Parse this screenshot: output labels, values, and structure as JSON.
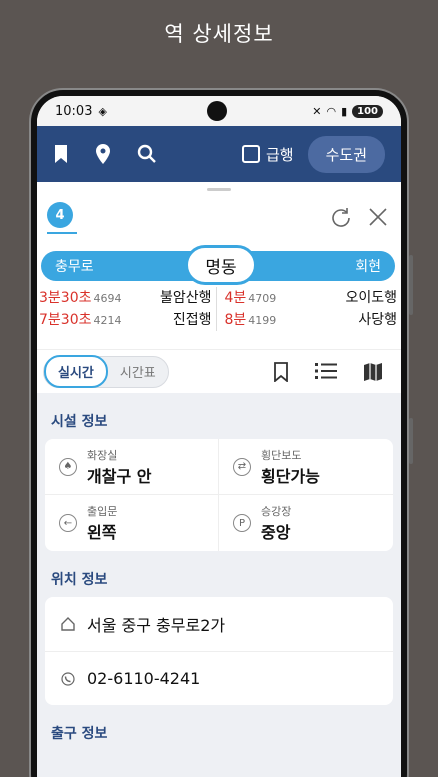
{
  "banner": {
    "title": "역 상세정보"
  },
  "statusbar": {
    "time": "10:03",
    "battery": "100"
  },
  "topbar": {
    "express_label": "급행",
    "region_label": "수도권"
  },
  "line": {
    "number": "4"
  },
  "stations": {
    "prev": "충무로",
    "current": "명동",
    "next": "회현"
  },
  "arrivals": {
    "left": [
      {
        "time": "3분30초",
        "train": "4694",
        "dest": "불암산행"
      },
      {
        "time": "7분30초",
        "train": "4214",
        "dest": "진접행"
      }
    ],
    "right": [
      {
        "time": "4분",
        "train": "4709",
        "dest": "오이도행"
      },
      {
        "time": "8분",
        "train": "4199",
        "dest": "사당행"
      }
    ]
  },
  "mode": {
    "realtime": "실시간",
    "timetable": "시간표"
  },
  "facility": {
    "title": "시설 정보",
    "items": [
      {
        "label": "화장실",
        "value": "개찰구 안"
      },
      {
        "label": "횡단보도",
        "value": "횡단가능"
      },
      {
        "label": "출입문",
        "value": "왼쪽"
      },
      {
        "label": "승강장",
        "value": "중앙"
      }
    ]
  },
  "location": {
    "title": "위치 정보",
    "address": "서울 중구 충무로2가",
    "phone": "02-6110-4241"
  },
  "exit": {
    "title": "출구 정보"
  },
  "colors": {
    "navy": "#2a4a7f",
    "line4": "#3aa6e0",
    "red": "#d9322b"
  }
}
